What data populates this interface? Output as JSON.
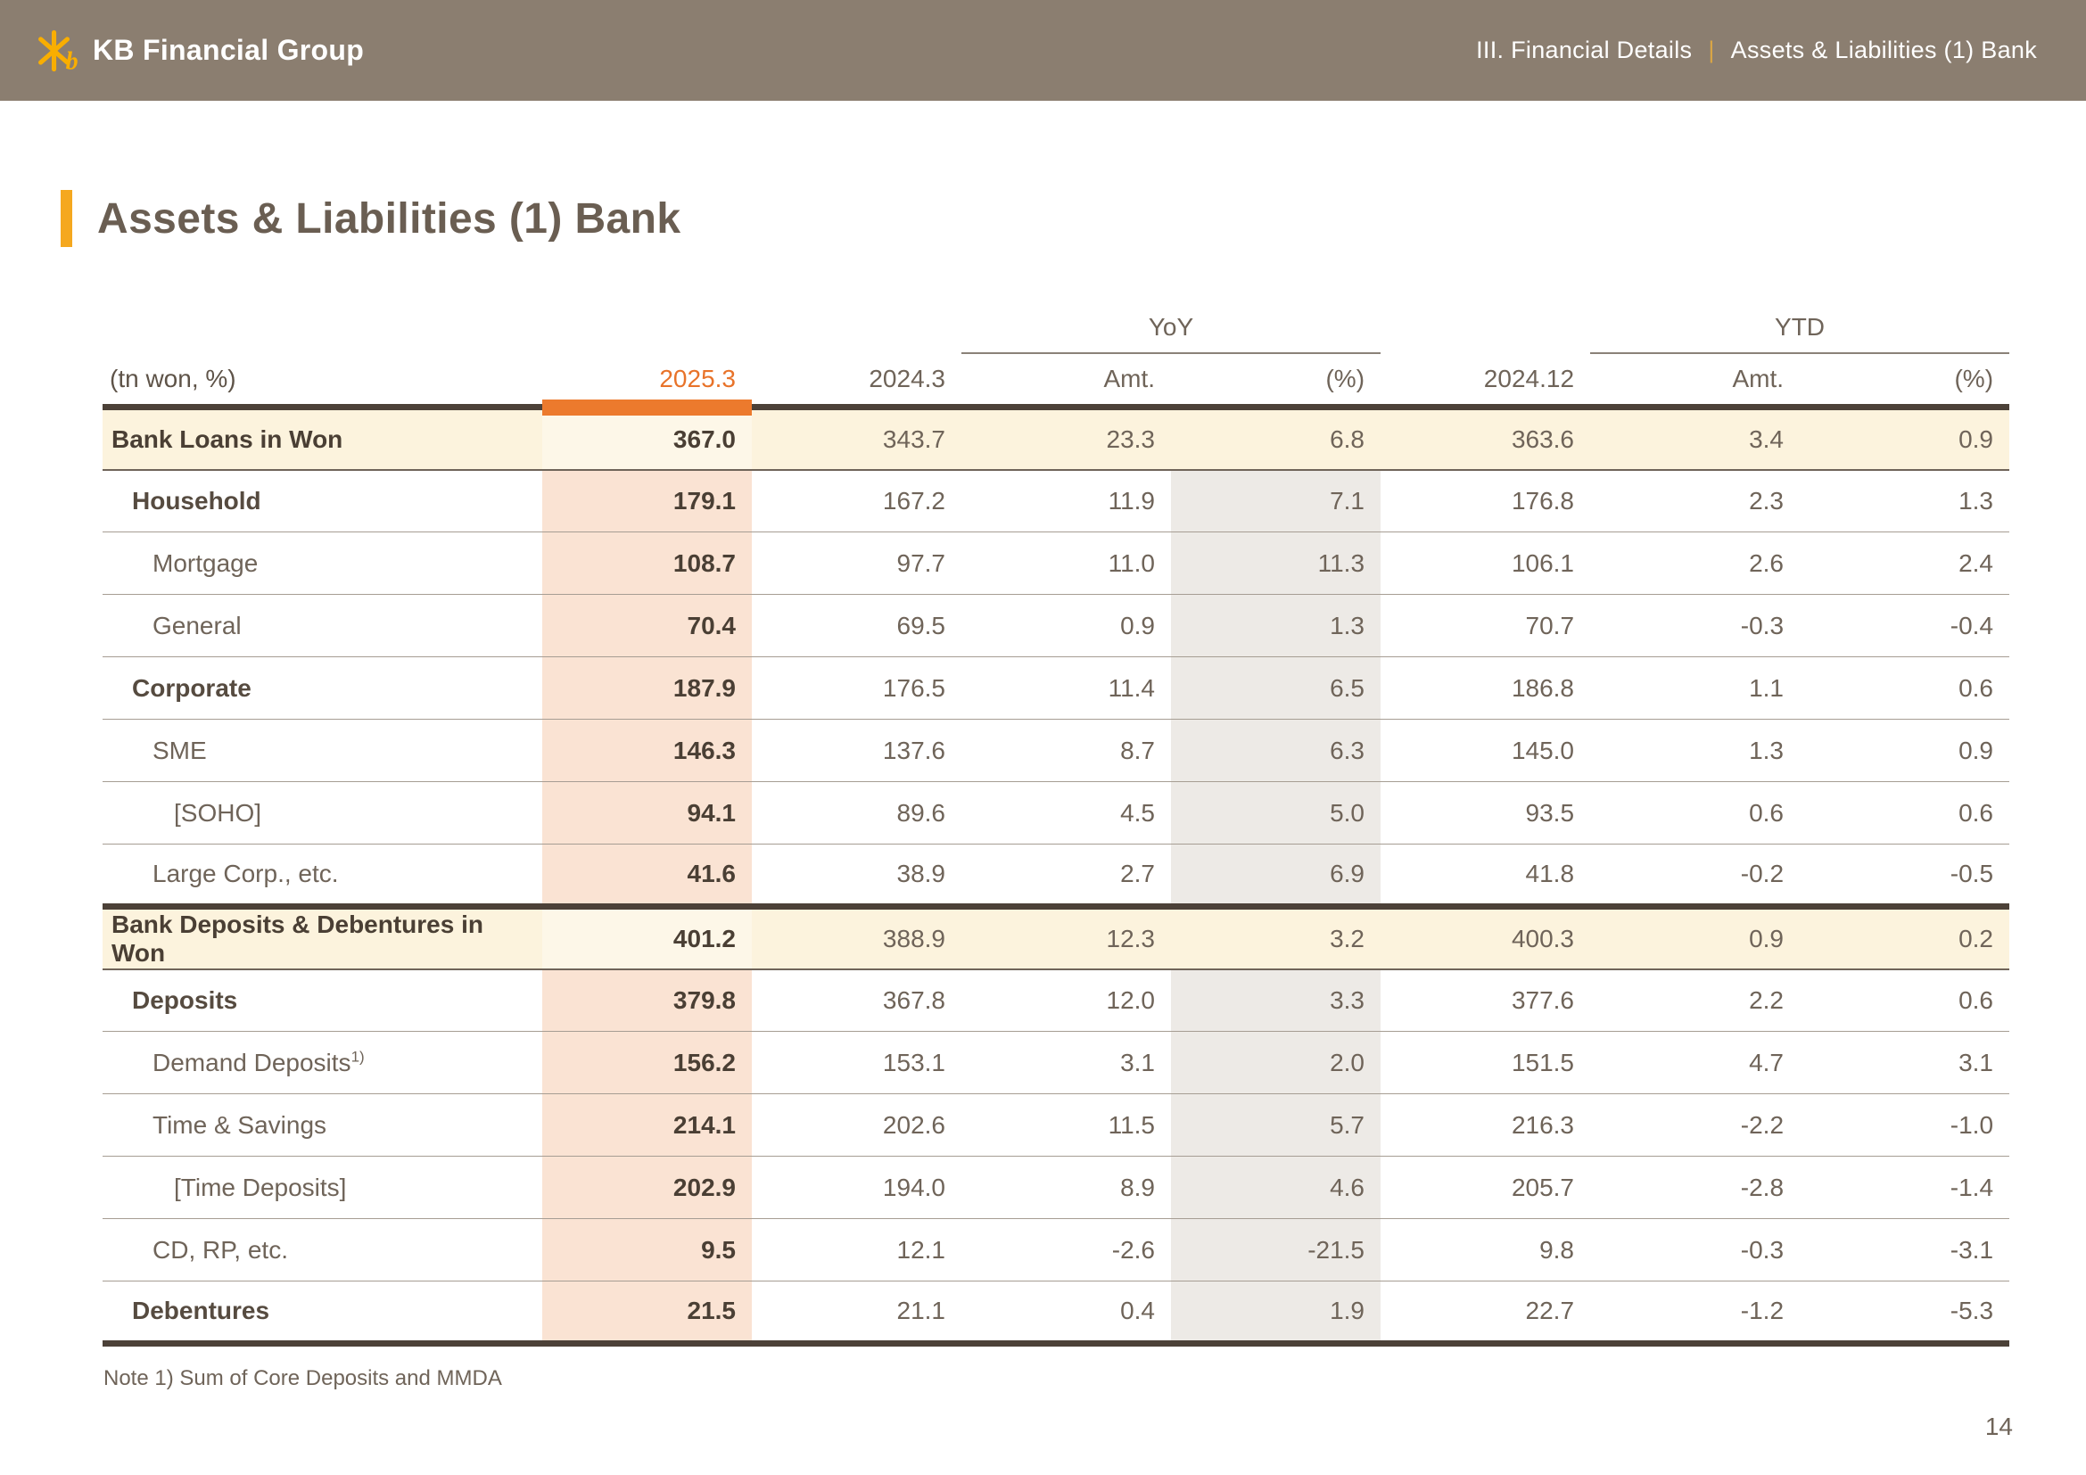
{
  "header": {
    "brand": "KB Financial Group",
    "section": "III. Financial Details",
    "separator": "|",
    "page": "Assets & Liabilities (1) Bank"
  },
  "title": "Assets & Liabilities (1) Bank",
  "table": {
    "unit_label": "(tn won, %)",
    "groups": [
      "YoY",
      "YTD"
    ],
    "col_headers": [
      "2025.3",
      "2024.3",
      "Amt.",
      "(%)",
      "2024.12",
      "Amt.",
      "(%)"
    ],
    "rows": [
      {
        "label": "Bank Loans in Won",
        "indent": 0,
        "style": "section",
        "values": [
          "367.0",
          "343.7",
          "23.3",
          "6.8",
          "363.6",
          "3.4",
          "0.9"
        ]
      },
      {
        "label": "Household",
        "indent": 1,
        "style": "sub",
        "values": [
          "179.1",
          "167.2",
          "11.9",
          "7.1",
          "176.8",
          "2.3",
          "1.3"
        ]
      },
      {
        "label": "Mortgage",
        "indent": 2,
        "style": "item",
        "values": [
          "108.7",
          "97.7",
          "11.0",
          "11.3",
          "106.1",
          "2.6",
          "2.4"
        ]
      },
      {
        "label": "General",
        "indent": 2,
        "style": "item",
        "values": [
          "70.4",
          "69.5",
          "0.9",
          "1.3",
          "70.7",
          "-0.3",
          "-0.4"
        ]
      },
      {
        "label": "Corporate",
        "indent": 1,
        "style": "sub",
        "values": [
          "187.9",
          "176.5",
          "11.4",
          "6.5",
          "186.8",
          "1.1",
          "0.6"
        ]
      },
      {
        "label": "SME",
        "indent": 2,
        "style": "item",
        "values": [
          "146.3",
          "137.6",
          "8.7",
          "6.3",
          "145.0",
          "1.3",
          "0.9"
        ]
      },
      {
        "label": "[SOHO]",
        "indent": 3,
        "style": "item",
        "values": [
          "94.1",
          "89.6",
          "4.5",
          "5.0",
          "93.5",
          "0.6",
          "0.6"
        ]
      },
      {
        "label": "Large Corp., etc.",
        "indent": 2,
        "style": "item",
        "section_end": true,
        "values": [
          "41.6",
          "38.9",
          "2.7",
          "6.9",
          "41.8",
          "-0.2",
          "-0.5"
        ]
      },
      {
        "label": "Bank Deposits & Debentures in Won",
        "indent": 0,
        "style": "section",
        "values": [
          "401.2",
          "388.9",
          "12.3",
          "3.2",
          "400.3",
          "0.9",
          "0.2"
        ]
      },
      {
        "label": "Deposits",
        "indent": 1,
        "style": "sub",
        "values": [
          "379.8",
          "367.8",
          "12.0",
          "3.3",
          "377.6",
          "2.2",
          "0.6"
        ]
      },
      {
        "label": "Demand Deposits",
        "sup": "1)",
        "indent": 2,
        "style": "item",
        "values": [
          "156.2",
          "153.1",
          "3.1",
          "2.0",
          "151.5",
          "4.7",
          "3.1"
        ]
      },
      {
        "label": "Time & Savings",
        "indent": 2,
        "style": "item",
        "values": [
          "214.1",
          "202.6",
          "11.5",
          "5.7",
          "216.3",
          "-2.2",
          "-1.0"
        ]
      },
      {
        "label": "[Time Deposits]",
        "indent": 3,
        "style": "item",
        "values": [
          "202.9",
          "194.0",
          "8.9",
          "4.6",
          "205.7",
          "-2.8",
          "-1.4"
        ]
      },
      {
        "label": "CD, RP, etc.",
        "indent": 2,
        "style": "item",
        "values": [
          "9.5",
          "12.1",
          "-2.6",
          "-21.5",
          "9.8",
          "-0.3",
          "-3.1"
        ]
      },
      {
        "label": "Debentures",
        "indent": 1,
        "style": "sub",
        "section_end": true,
        "values": [
          "21.5",
          "21.1",
          "0.4",
          "1.9",
          "22.7",
          "-1.2",
          "-5.3"
        ]
      }
    ]
  },
  "note": "Note 1) Sum of Core Deposits and MMDA",
  "page_number": "14",
  "colors": {
    "top_bar_bg": "#8B7E70",
    "brand_gold": "#F9AE00",
    "title_accent": "#F5A81F",
    "current_period_orange": "#E8732A",
    "current_bar_orange": "#EC7A2D",
    "section_row_bg": "#FCF3DD",
    "current_col_bg": "#FAE3D3",
    "pct_col_bg": "#EDEAE6",
    "thick_rule": "#4C4138"
  }
}
